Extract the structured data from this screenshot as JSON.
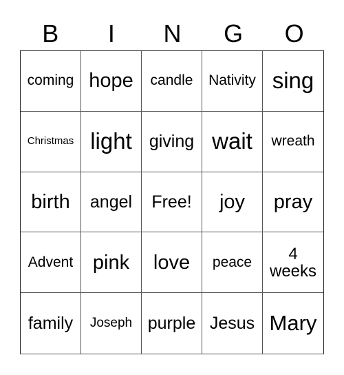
{
  "header": {
    "letters": [
      "B",
      "I",
      "N",
      "G",
      "O"
    ]
  },
  "board": {
    "rows": [
      [
        "coming",
        "hope",
        "candle",
        "Nativity",
        "sing"
      ],
      [
        "Christmas",
        "light",
        "giving",
        "wait",
        "wreath"
      ],
      [
        "birth",
        "angel",
        "Free!",
        "joy",
        "pray"
      ],
      [
        "Advent",
        "pink",
        "love",
        "peace",
        "4 weeks"
      ],
      [
        "family",
        "Joseph",
        "purple",
        "Jesus",
        "Mary"
      ]
    ],
    "free_space": "Free!"
  }
}
